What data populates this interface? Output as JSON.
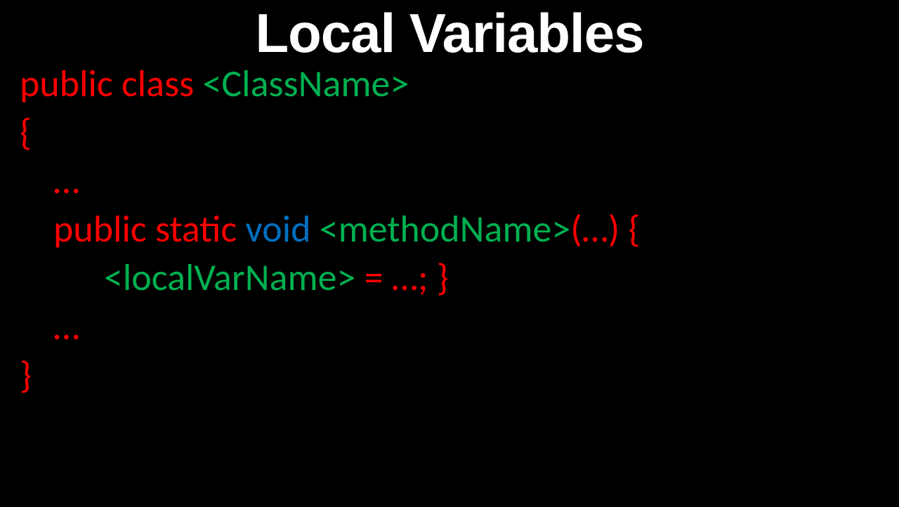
{
  "title": "Local Variables",
  "code": {
    "keyword_public_class": "public class ",
    "class_name": "<ClassName>",
    "open_brace": "{",
    "ellipsis1": "…",
    "keyword_public_static": "public static ",
    "keyword_void": "void ",
    "method_name": "<methodName>",
    "paren_brace": "(…) {",
    "local_var": "<localVarName>",
    "assign_close": " = …; }",
    "ellipsis2": "…",
    "close_brace": "}"
  }
}
